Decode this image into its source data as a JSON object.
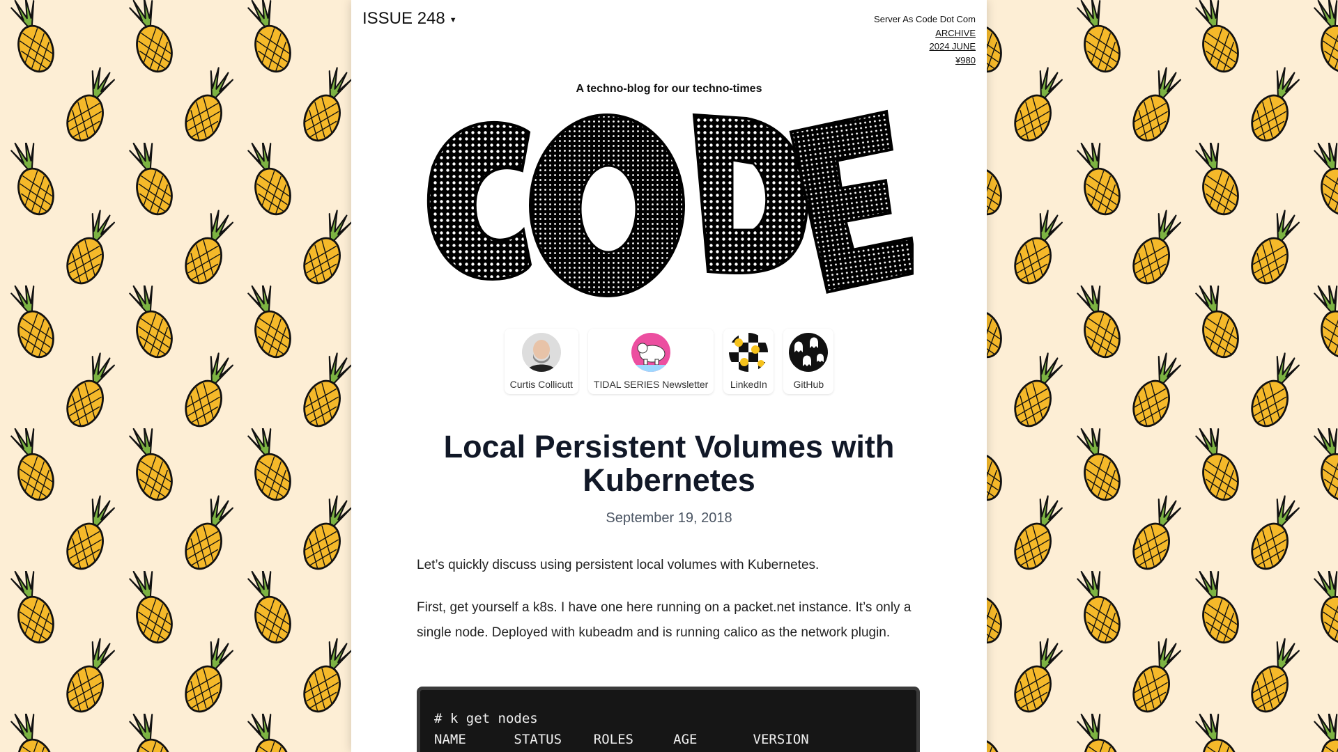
{
  "header": {
    "issue": "ISSUE 248",
    "site_name": "Server As Code Dot Com",
    "archive": "ARCHIVE",
    "edition": "2024 JUNE",
    "price": "¥980"
  },
  "tagline": "A techno-blog for our techno-times",
  "logo_text": "CODE",
  "links": [
    {
      "label": "Curtis Collicutt",
      "icon": "author-avatar-icon"
    },
    {
      "label": "TIDAL SERIES Newsletter",
      "icon": "polar-bear-icon"
    },
    {
      "label": "LinkedIn",
      "icon": "smiley-checker-icon"
    },
    {
      "label": "GitHub",
      "icon": "ghost-pattern-icon"
    }
  ],
  "article": {
    "title": "Local Persistent Volumes with Kubernetes",
    "date": "September 19, 2018",
    "p1": "Let’s quickly discuss using persistent local volumes with Kubernetes.",
    "p2": "First, get yourself a k8s. I have one here running on a packet.net instance. It’s only a single node. Deployed with kubeadm and is running calico as the network plugin.",
    "code_line1": "# k get nodes",
    "code_line2": "NAME      STATUS    ROLES     AGE       VERSION"
  },
  "colors": {
    "background": "#fdeed5",
    "pineapple_body": "#f5b92a",
    "pineapple_leaf": "#7cb342",
    "code_bg": "#161616"
  }
}
